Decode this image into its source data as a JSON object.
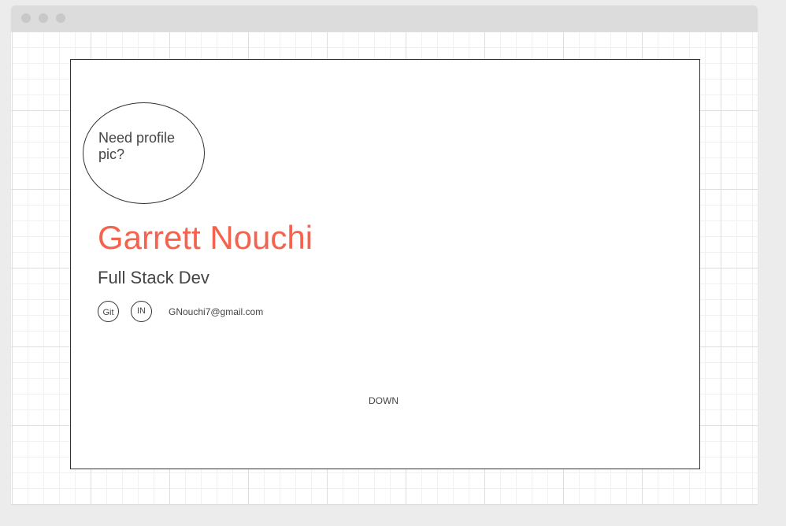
{
  "profile": {
    "avatar_placeholder": "Need profile pic?",
    "name": "Garrett Nouchi",
    "role": "Full Stack Dev",
    "email": "GNouchi7@gmail.com"
  },
  "social": {
    "git_label": "Git",
    "linkedin_label": "IN"
  },
  "nav": {
    "down_label": "DOWN"
  },
  "colors": {
    "name_accent": "#f5624d",
    "text": "#444444",
    "border": "#333333",
    "canvas_bg": "#ececec"
  },
  "icons": {
    "window_controls": [
      "window-dot-icon",
      "window-dot-icon",
      "window-dot-icon"
    ]
  }
}
